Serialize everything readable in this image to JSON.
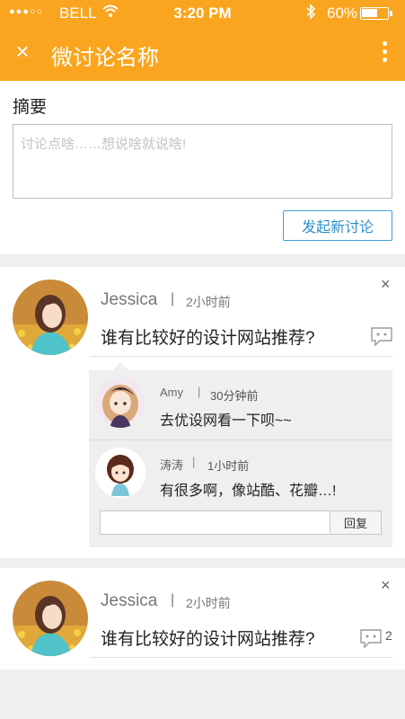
{
  "status_bar": {
    "signal_dots": "●●●○○",
    "carrier": "BELL",
    "time": "3:20 PM",
    "battery": "60%",
    "battery_level": 0.6
  },
  "nav": {
    "title": "微讨论名称"
  },
  "composer": {
    "label": "摘要",
    "placeholder": "讨论点啥……想说啥就说啥!",
    "value": "",
    "submit_label": "发起新讨论"
  },
  "posts": [
    {
      "author": "Jessica",
      "separator": "|",
      "time": "2小时前",
      "content": "谁有比较好的设计网站推荐?",
      "replies": [
        {
          "name": "Amy",
          "separator": "|",
          "time": "30分钟前",
          "text": "去优设网看一下呗~~"
        },
        {
          "name": "涛涛",
          "separator": "|",
          "time": "1小时前",
          "text": "有很多啊，像站酷、花瓣…!"
        }
      ],
      "reply_input": {
        "value": "",
        "placeholder": ""
      },
      "reply_button": "回复"
    },
    {
      "author": "Jessica",
      "separator": "|",
      "time": "2小时前",
      "content": "谁有比较好的设计网站推荐?",
      "comment_count": "2"
    }
  ],
  "icons": {
    "close": "×",
    "dismiss": "×",
    "more": "more-vertical-icon",
    "comment": "speech-bubble-icon"
  },
  "colors": {
    "brand": "#f9a51f",
    "link": "#2e8fca"
  }
}
